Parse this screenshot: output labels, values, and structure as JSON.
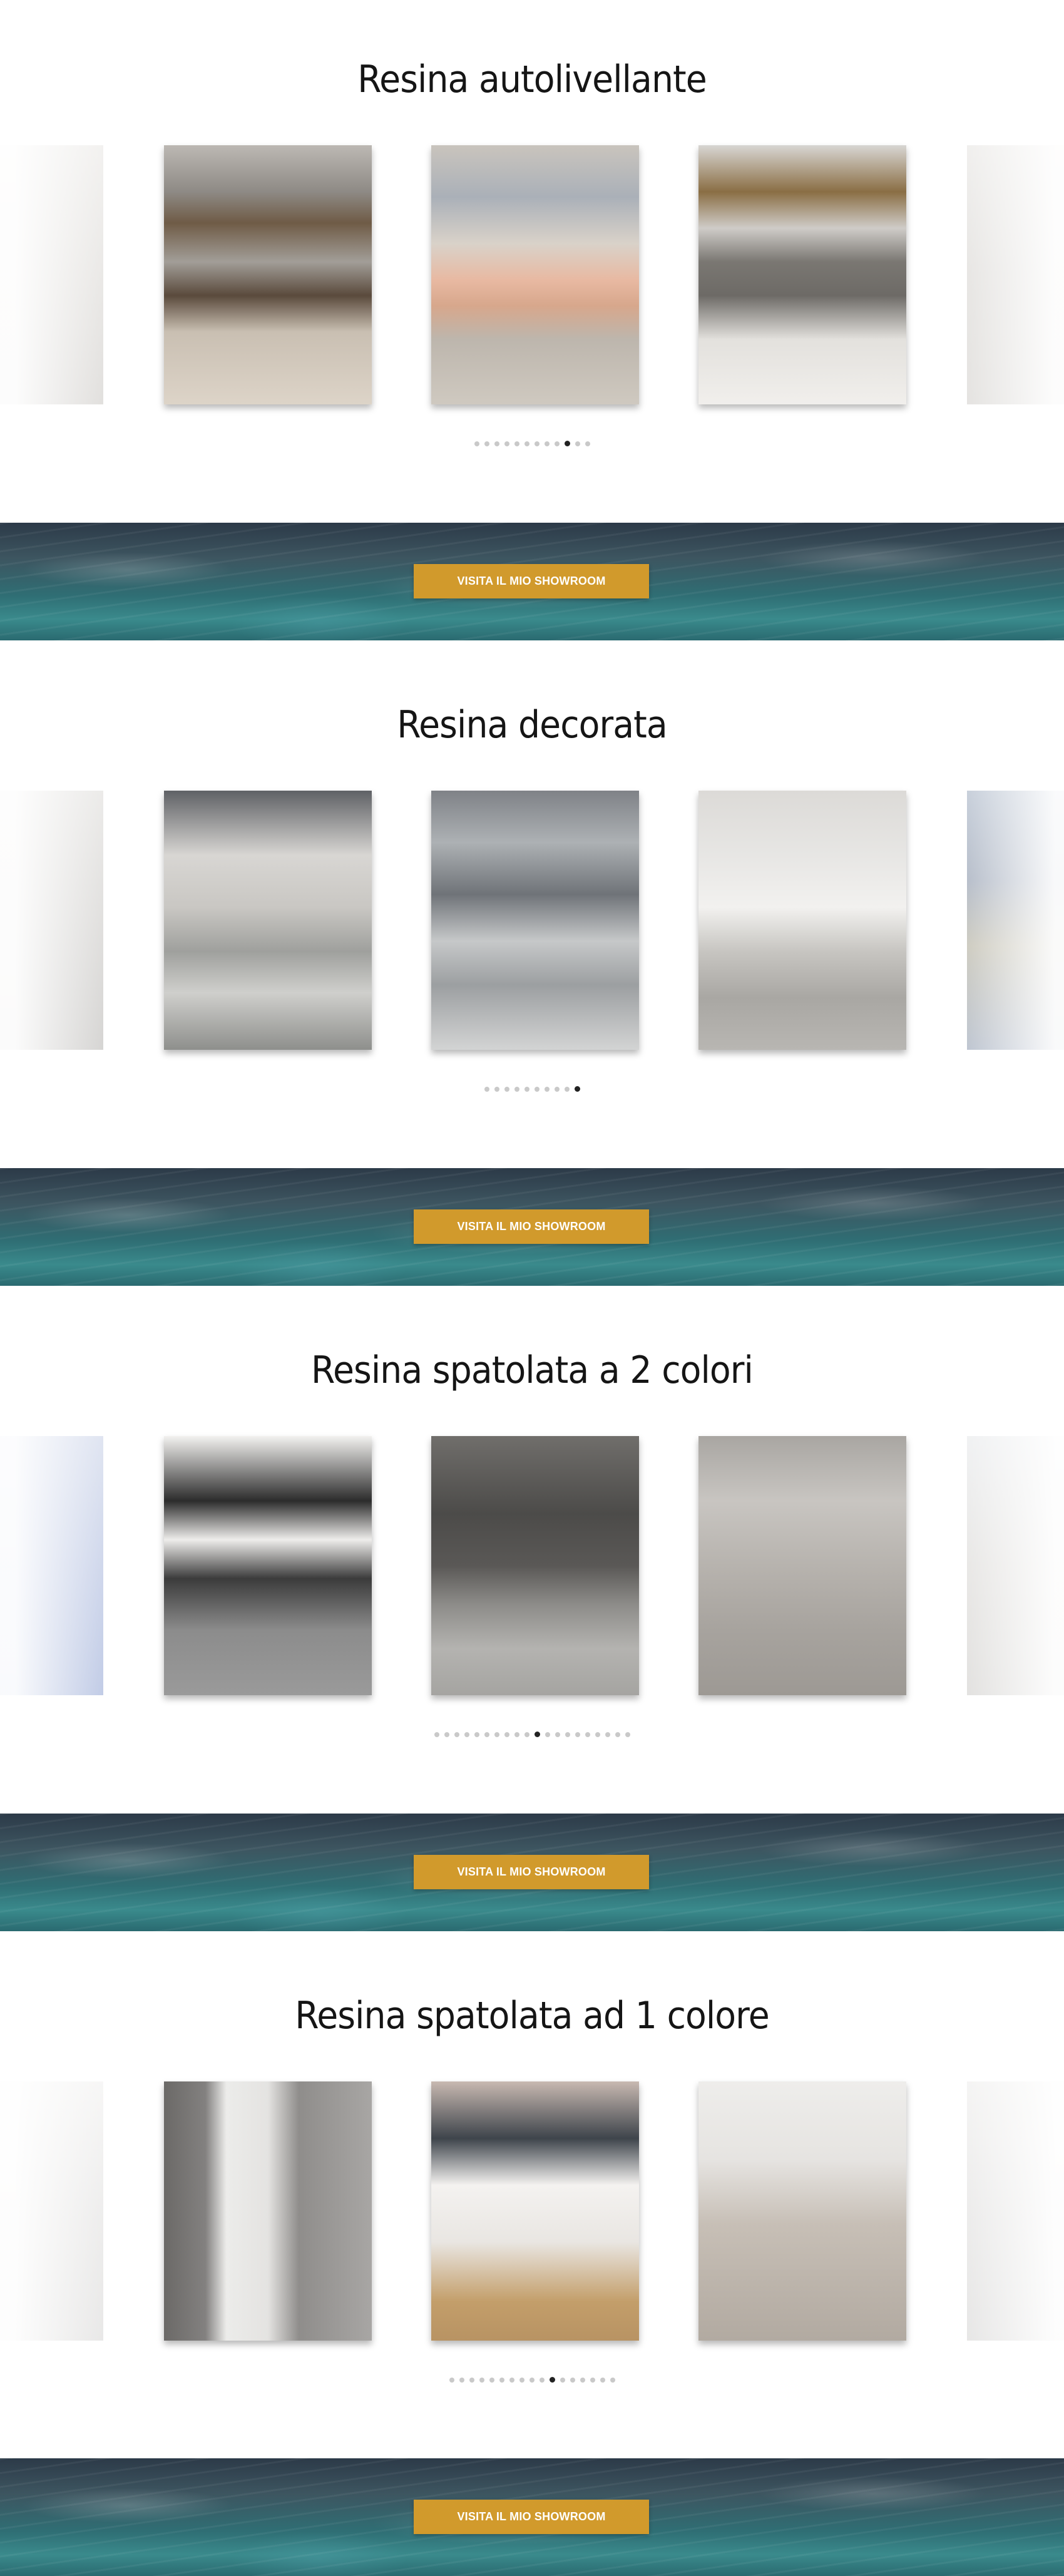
{
  "sections": [
    {
      "title": "Resina autolivellante",
      "slides": [
        {
          "label": "bathroom-fragment",
          "bg": "linear-gradient(180deg,#e8e6e3 0%,#d9d6d2 50%,#c9c6c2 100%)"
        },
        {
          "label": "dining-room",
          "bg": "linear-gradient(180deg,#bcb8b3 0%,#8e8a85 18%,#6f5b46 30%,#a29e98 45%,#5a4a3c 58%,#c9bfb2 72%,#ddd4c8 100%)"
        },
        {
          "label": "bedroom",
          "bg": "linear-gradient(180deg,#c9c4bd 0%,#aab0b8 20%,#d9d2c9 38%,#e8b9a2 52%,#d7a78c 62%,#bdb6ad 75%,#cfc9c0 100%)"
        },
        {
          "label": "living-room-dog",
          "bg": "linear-gradient(180deg,#d8d6d3 0%,#8a6e44 18%,#cfccc8 32%,#7a7772 45%,#6d6a66 58%,#e3e1dd 75%,#f1efec 100%)"
        },
        {
          "label": "bathroom-fragment-right",
          "bg": "linear-gradient(180deg,#e4e2df 0%,#d4d1cd 50%,#cfccc8 100%)"
        }
      ],
      "dots_total": 12,
      "dots_active": 10
    },
    {
      "title": "Resina decorata",
      "slides": [
        {
          "label": "hallway-fragment",
          "bg": "linear-gradient(180deg,#dcdad7 0%,#c8c6c3 50%,#b4b2af 100%)"
        },
        {
          "label": "hallway-marble",
          "bg": "linear-gradient(180deg,#5f6165 0%,#d8d6d3 25%,#c9c7c3 45%,#9fa09d 62%,#cfcfcc 78%,#8e8f8c 100%)"
        },
        {
          "label": "bathroom-glass",
          "bg": "linear-gradient(180deg,#7f8287 0%,#adb1b4 20%,#6f7378 40%,#c6c8c9 58%,#9c9fa1 75%,#d3d4d4 100%)"
        },
        {
          "label": "white-dresser",
          "bg": "linear-gradient(180deg,#dcdad7 0%,#e7e6e4 25%,#f2f1ef 45%,#c7c5c1 62%,#a9a7a3 80%,#b8b6b2 100%)"
        },
        {
          "label": "decor-fragment-right",
          "bg": "linear-gradient(180deg,#9ba9bd 0%,#7d8aa0 35%,#a7a38f 60%,#8a97ac 100%)"
        }
      ],
      "dots_total": 10,
      "dots_active": 10
    },
    {
      "title": "Resina spatolata a 2 colori",
      "slides": [
        {
          "label": "blue-fragment",
          "bg": "linear-gradient(180deg,#c6cfe6 0%,#a9b7dc 50%,#8fa2d2 100%)"
        },
        {
          "label": "black-stairs",
          "bg": "linear-gradient(180deg,#f3f2f0 0%,#2c2c2c 25%,#eeedeb 40%,#3b3b3b 55%,#8c8c8c 75%,#9a9a9a 100%)"
        },
        {
          "label": "grey-sofa",
          "bg": "linear-gradient(180deg,#706e6b 0%,#4c4b49 30%,#5a5856 50%,#8d8c89 65%,#b4b3b0 82%,#a5a4a1 100%)"
        },
        {
          "label": "concrete-stairs",
          "bg": "linear-gradient(180deg,#a9a6a2 0%,#c8c5c1 25%,#b7b3ae 50%,#a7a39e 75%,#9d9994 100%)"
        },
        {
          "label": "bathroom-fragment-right",
          "bg": "linear-gradient(180deg,#e4e6e8 0%,#d6d4d1 50%,#cbc9c6 100%)"
        }
      ],
      "dots_total": 20,
      "dots_active": 11
    },
    {
      "title": "Resina spatolata ad 1 colore",
      "slides": [
        {
          "label": "white-fragment",
          "bg": "linear-gradient(180deg,#f0efee 0%,#e0dfde 50%,#d6d5d4 100%)"
        },
        {
          "label": "towel-radiator",
          "bg": "linear-gradient(90deg,#6b6967 0%,#838180 20%,#ececea 30%,#e4e3e1 50%,#8f8d8b 65%,#a8a6a4 100%)"
        },
        {
          "label": "white-vanity",
          "bg": "linear-gradient(180deg,#c8b9b1 0%,#3e444b 22%,#f4f2f0 40%,#e9e6e2 62%,#c39e6a 85%,#b89363 100%)"
        },
        {
          "label": "empty-room",
          "bg": "linear-gradient(180deg,#eeedeb 0%,#e6e4e1 30%,#c7bfb6 55%,#bbb3aa 80%,#b2aaa1 100%)"
        },
        {
          "label": "white-fragment-right",
          "bg": "linear-gradient(180deg,#ecebea 0%,#dddcdb 50%,#d3d2d1 100%)"
        }
      ],
      "dots_total": 17,
      "dots_active": 11
    }
  ],
  "banner": {
    "button_label": "VISITA IL MIO SHOWROOM",
    "button_color": "#d19a2c"
  }
}
